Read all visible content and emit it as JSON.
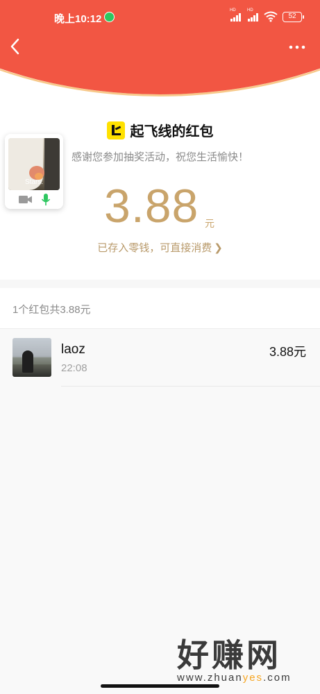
{
  "status_bar": {
    "time": "晚上10:12",
    "battery": "52"
  },
  "colors": {
    "header_red": "#f25643",
    "gold": "#c9a46b",
    "wechat_green": "#2ec760"
  },
  "nav": {
    "back_icon": "chevron-left-icon",
    "more_icon": "more-dots-icon"
  },
  "packet": {
    "sender_name": "起飞线的红包",
    "wish": "感谢您参加抽奖活动，祝您生活愉快！",
    "amount": "3.88",
    "unit": "元",
    "change_link": "已存入零钱，可直接消费",
    "change_chevron": "❯"
  },
  "video_float": {
    "caption": "Stars."
  },
  "summary": {
    "text": "1个红包共3.88元"
  },
  "records": [
    {
      "name": "laoz",
      "time": "22:08",
      "amount": "3.88元"
    }
  ],
  "watermark": {
    "title": "好赚网",
    "url_prefix": "www.zhuan",
    "url_highlight": "yes",
    "url_suffix": ".com"
  }
}
